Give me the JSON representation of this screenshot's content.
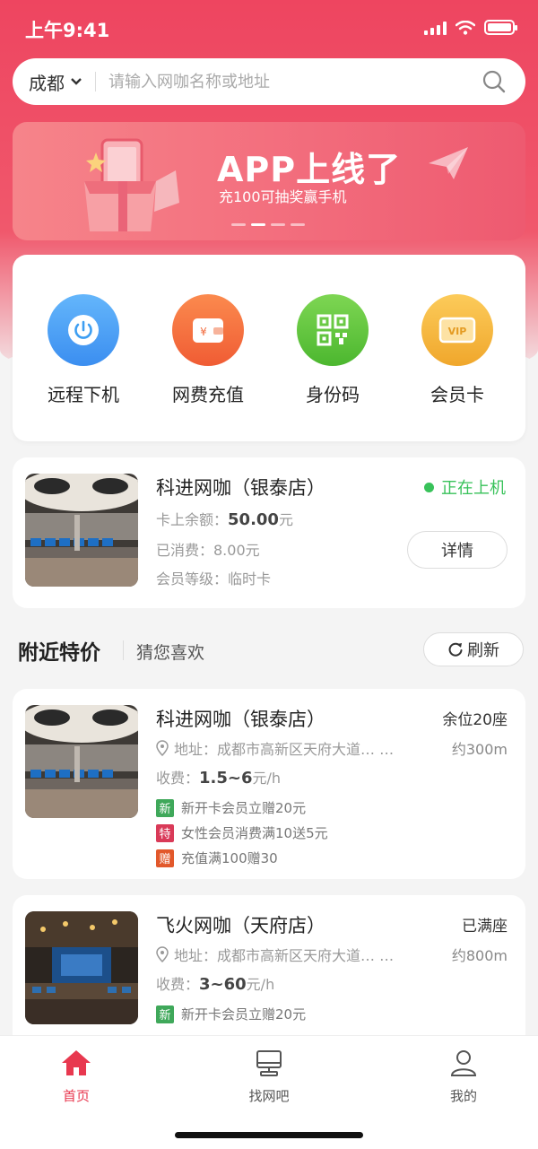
{
  "status": {
    "time": "上午9:41"
  },
  "search": {
    "city": "成都",
    "placeholder": "请输入网咖名称或地址"
  },
  "banner": {
    "title": "APP上线了",
    "subtitle": "充100可抽奖赢手机"
  },
  "quick_actions": [
    {
      "label": "远程下机",
      "icon": "power-icon",
      "color": "#3d9ef2"
    },
    {
      "label": "网费充值",
      "icon": "wallet-icon",
      "color": "#f26a3c"
    },
    {
      "label": "身份码",
      "icon": "qrcode-icon",
      "color": "#5cc239"
    },
    {
      "label": "会员卡",
      "icon": "vip-card-icon",
      "color": "#f3b43a"
    }
  ],
  "current": {
    "name": "科进网咖（银泰店）",
    "status": "正在上机",
    "balance_label": "卡上余额：",
    "balance": "50.00",
    "balance_unit": "元",
    "spent": "已消费：8.00元",
    "level": "会员等级：临时卡",
    "detail_label": "详情"
  },
  "section": {
    "title": "附近特价",
    "subtitle": "猜您喜欢",
    "refresh_label": "刷新"
  },
  "cafes": [
    {
      "name": "科进网咖（银泰店）",
      "seats": "余位20座",
      "address": "地址：成都市高新区天府大道…  …",
      "distance": "约300m",
      "price_label": "收费：",
      "price": "1.5~6",
      "price_unit": "元/h",
      "promos": [
        {
          "tag": "新",
          "text": "新开卡会员立赠20元",
          "color": "#3fa85a"
        },
        {
          "tag": "特",
          "text": "女性会员消费满10送5元",
          "color": "#d93a58"
        },
        {
          "tag": "赠",
          "text": "充值满100赠30",
          "color": "#e2582b"
        }
      ]
    },
    {
      "name": "飞火网咖（天府店）",
      "seats": "已满座",
      "address": "地址：成都市高新区天府大道…  …",
      "distance": "约800m",
      "price_label": "收费：",
      "price": "3~60",
      "price_unit": "元/h",
      "promos": [
        {
          "tag": "新",
          "text": "新开卡会员立赠20元",
          "color": "#3fa85a"
        }
      ]
    }
  ],
  "tabs": [
    {
      "label": "首页",
      "icon": "home-icon",
      "active": true
    },
    {
      "label": "找网吧",
      "icon": "computer-icon",
      "active": false
    },
    {
      "label": "我的",
      "icon": "user-icon",
      "active": false
    }
  ],
  "colors": {
    "brand": "#e8384f",
    "online": "#38c25a"
  }
}
